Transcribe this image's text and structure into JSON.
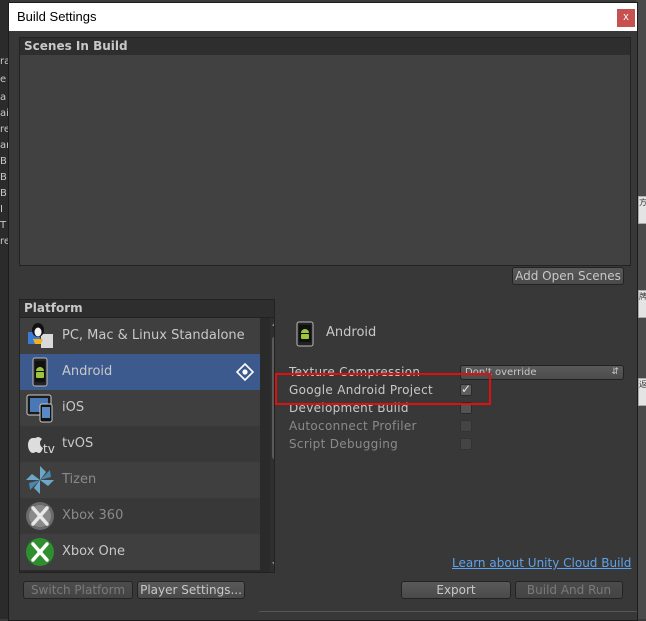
{
  "window": {
    "title": "Build Settings",
    "close_glyph": "x"
  },
  "background": {
    "left_fragments": [
      "ra",
      "e",
      "a",
      "ai",
      "re",
      "ar",
      "B",
      "B",
      "B",
      "I",
      "T",
      "re"
    ],
    "right_fragments": [
      "方",
      "牌",
      "返"
    ]
  },
  "scenes": {
    "header": "Scenes In Build",
    "add_open_scenes_label": "Add Open Scenes"
  },
  "platform": {
    "header": "Platform",
    "items": [
      {
        "label": "PC, Mac & Linux Standalone",
        "icon": "pc-standalone-icon"
      },
      {
        "label": "Android",
        "icon": "android-icon",
        "selected": true
      },
      {
        "label": "iOS",
        "icon": "ios-icon"
      },
      {
        "label": "tvOS",
        "icon": "tvos-icon"
      },
      {
        "label": "Tizen",
        "icon": "tizen-icon"
      },
      {
        "label": "Xbox 360",
        "icon": "xbox360-icon"
      },
      {
        "label": "Xbox One",
        "icon": "xboxone-icon"
      }
    ]
  },
  "settings": {
    "selected_platform": "Android",
    "texture_compression_label": "Texture Compression",
    "texture_compression_value": "Don't override",
    "google_android_project_label": "Google Android Project",
    "google_android_project_checked": true,
    "development_build_label": "Development Build",
    "development_build_checked": false,
    "autoconnect_profiler_label": "Autoconnect Profiler",
    "autoconnect_profiler_checked": false,
    "script_debugging_label": "Script Debugging",
    "script_debugging_checked": false
  },
  "footer": {
    "cloud_build_link": "Learn about Unity Cloud Build",
    "switch_platform_label": "Switch Platform",
    "player_settings_label": "Player Settings...",
    "export_label": "Export",
    "build_and_run_label": "Build And Run"
  },
  "colors": {
    "selected_row": "#3d5a8f",
    "highlight_box": "#e01010",
    "link": "#5fa2ec"
  }
}
